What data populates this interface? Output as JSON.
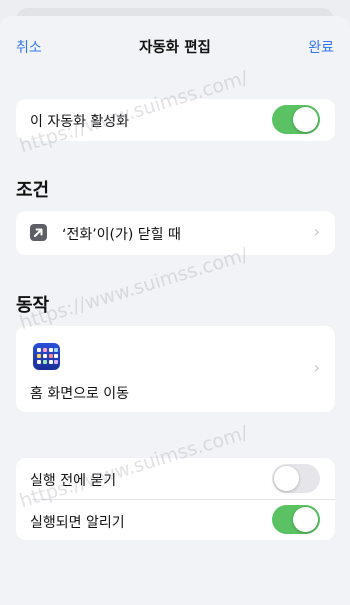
{
  "navbar": {
    "cancel_label": "취소",
    "title": "자동화 편집",
    "done_label": "완료"
  },
  "enable_row": {
    "label": "이 자동화 활성화",
    "toggle_on": true
  },
  "conditions": {
    "header": "조건",
    "item_label": "‘전화’이(가) 닫힐 때",
    "icon": "arrow-up-right-icon"
  },
  "actions": {
    "header": "동작",
    "item_label": "홈 화면으로 이동",
    "icon": "home-screen-app-icon"
  },
  "settings": {
    "ask_before_running": {
      "label": "실행 전에 묻기",
      "toggle_on": false
    },
    "notify_when_run": {
      "label": "실행되면 알리기",
      "toggle_on": true
    }
  },
  "watermark": {
    "text": "https://www.suimss.com/"
  },
  "colors": {
    "accent": "#3478f6",
    "toggle_on": "#5ac262",
    "toggle_off": "#e6e6ea",
    "background": "#f2f3f6"
  }
}
